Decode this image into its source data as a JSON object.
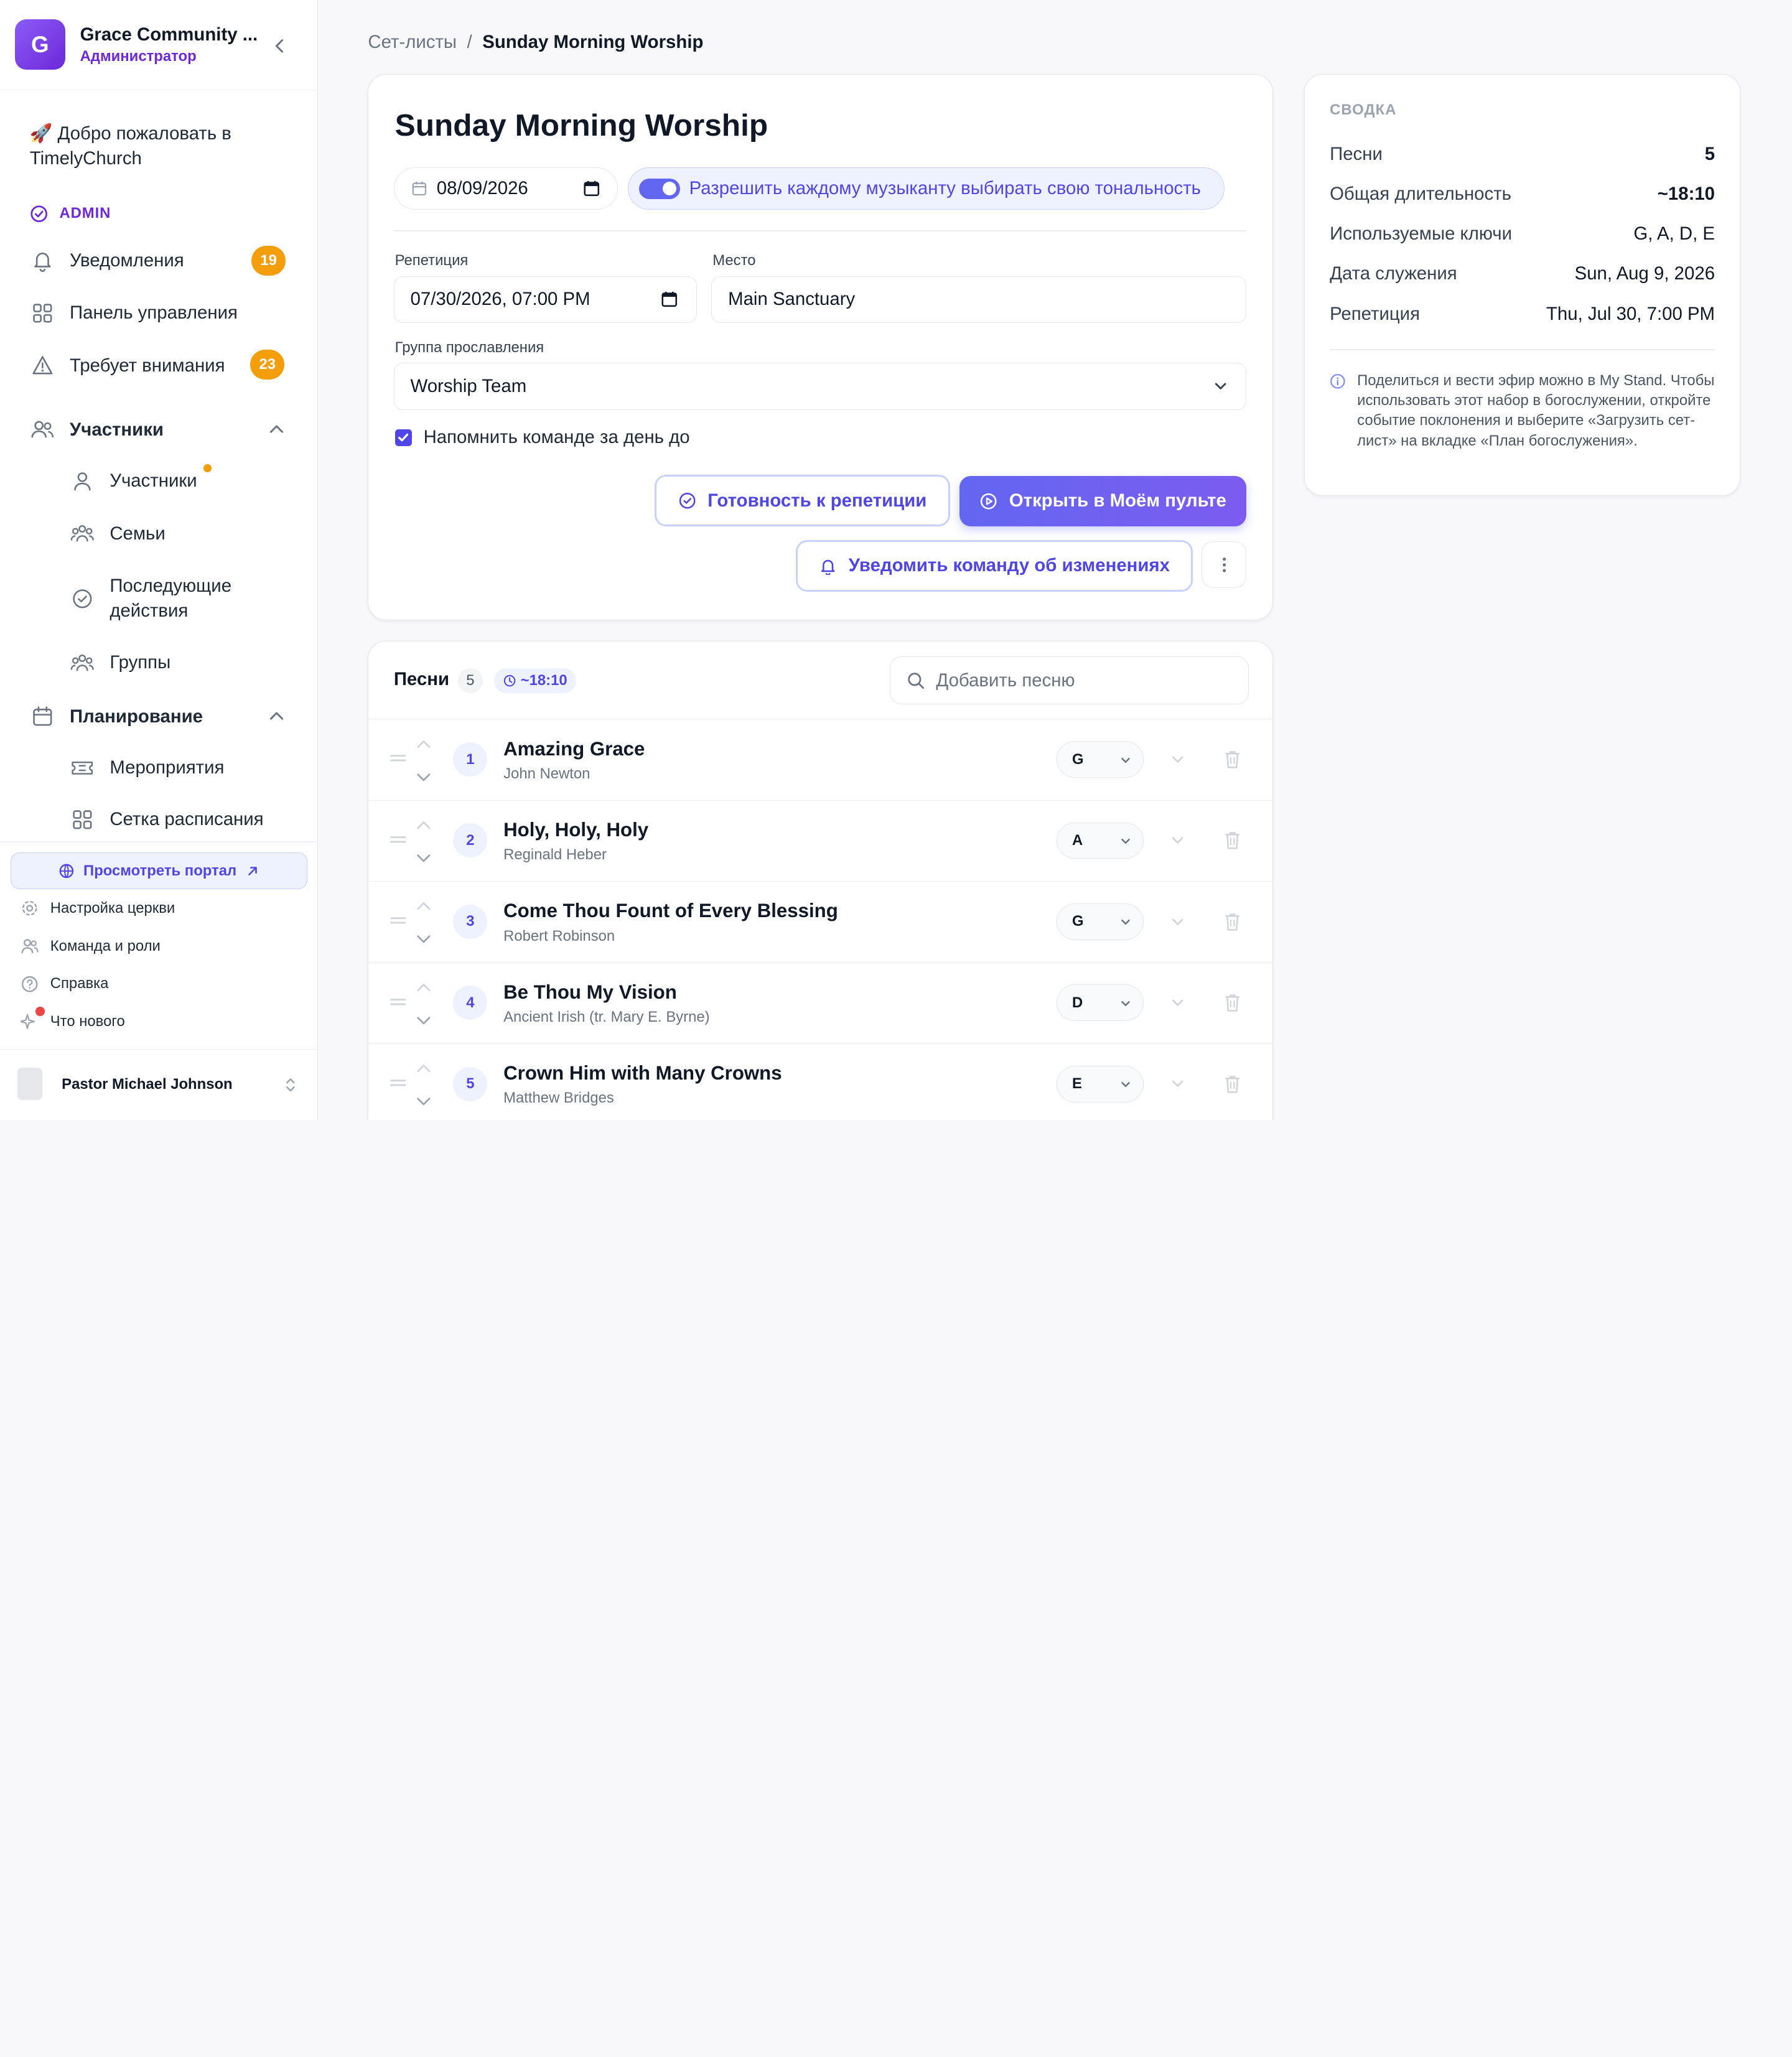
{
  "sidebar": {
    "org_initial": "G",
    "org_name": "Grace Community ...",
    "org_role": "Администратор",
    "welcome": "🚀 Добро пожаловать в TimelyChurch",
    "admin_label": "ADMIN",
    "nav": {
      "notifications": {
        "label": "Уведомления",
        "badge": "19"
      },
      "dashboard": {
        "label": "Панель управления"
      },
      "attention": {
        "label": "Требует внимания",
        "badge": "23"
      },
      "members": {
        "label": "Участники"
      },
      "members_sub": [
        "Участники",
        "Семьи",
        "Последующие действия",
        "Группы"
      ],
      "planning": {
        "label": "Планирование"
      },
      "planning_sub": [
        "Мероприятия",
        "Сетка расписания"
      ]
    },
    "portal_button": "Просмотреть портал",
    "footer_links": [
      "Настройка церкви",
      "Команда и роли",
      "Справка",
      "Что нового"
    ],
    "user_name": "Pastor Michael Johnson"
  },
  "breadcrumb": {
    "parent": "Сет-листы",
    "separator": "/",
    "current": "Sunday Morning Worship"
  },
  "setlist": {
    "title": "Sunday Morning Worship",
    "service_date": "08/09/2026",
    "toggle_label": "Разрешить каждому музыканту выбирать свою тональность",
    "toggle_on": true,
    "rehearsal_label": "Репетиция",
    "rehearsal_value": "07/30/2026, 07:00 PM",
    "location_label": "Место",
    "location_value": "Main Sanctuary",
    "team_label": "Группа прославления",
    "team_value": "Worship Team",
    "remind_label": "Напомнить команде за день до",
    "remind_checked": true,
    "readiness_button": "Готовность к репетиции",
    "open_stand_button": "Открыть в Моём пульте",
    "notify_button": "Уведомить команду об изменениях"
  },
  "songs": {
    "title": "Песни",
    "count": "5",
    "duration": "~18:10",
    "add_placeholder": "Добавить песню",
    "items": [
      {
        "num": "1",
        "title": "Amazing Grace",
        "author": "John Newton",
        "key": "G"
      },
      {
        "num": "2",
        "title": "Holy, Holy, Holy",
        "author": "Reginald Heber",
        "key": "A"
      },
      {
        "num": "3",
        "title": "Come Thou Fount of Every Blessing",
        "author": "Robert Robinson",
        "key": "G"
      },
      {
        "num": "4",
        "title": "Be Thou My Vision",
        "author": "Ancient Irish (tr. Mary E. Byrne)",
        "key": "D"
      },
      {
        "num": "5",
        "title": "Crown Him with Many Crowns",
        "author": "Matthew Bridges",
        "key": "E"
      }
    ]
  },
  "summary": {
    "heading": "СВОДКА",
    "rows": [
      {
        "k": "Песни",
        "v": "5"
      },
      {
        "k": "Общая длительность",
        "v": "~18:10"
      },
      {
        "k": "Используемые ключи",
        "v": "G, A, D, E"
      },
      {
        "k": "Дата служения",
        "v": "Sun, Aug 9, 2026"
      },
      {
        "k": "Репетиция",
        "v": "Thu, Jul 30, 7:00 PM"
      }
    ],
    "note": "Поделиться и вести эфир можно в My Stand. Чтобы использовать этот набор в богослужении, откройте событие поклонения и выберите «Загрузить сет-лист» на вкладке «План богослужения»."
  },
  "colors": {
    "accent": "#4f46e5",
    "brand": "#6d28d9",
    "badge": "#f59e0b",
    "alert": "#ef4444"
  }
}
